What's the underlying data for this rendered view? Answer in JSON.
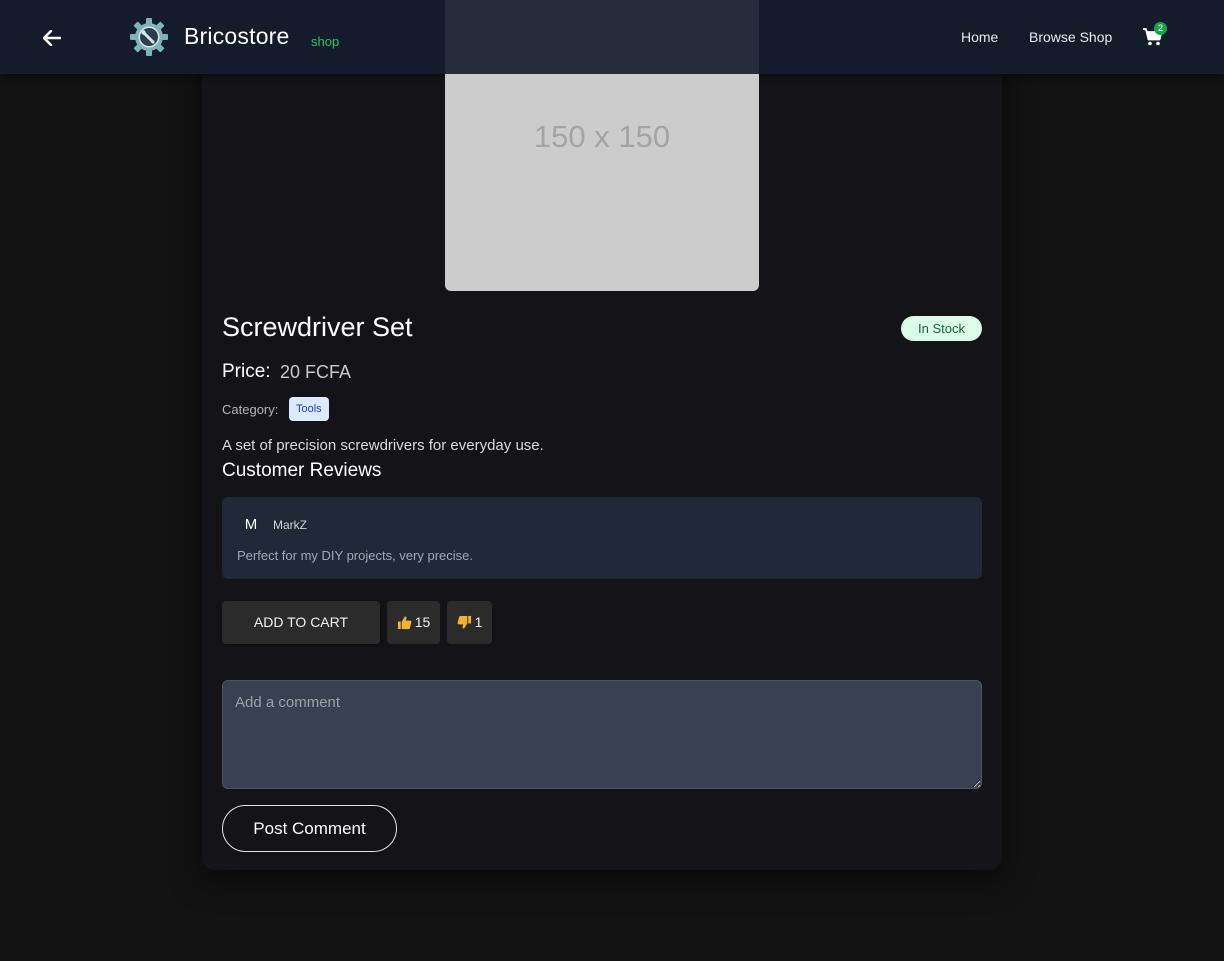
{
  "header": {
    "brand": "Bricostore",
    "brand_sub": "shop",
    "nav": {
      "home": "Home",
      "browse": "Browse Shop"
    },
    "cart_count": "2"
  },
  "product": {
    "image_placeholder": "150 x 150",
    "title": "Screwdriver Set",
    "stock": "In Stock",
    "price_label": "Price:",
    "price_value": "20 FCFA",
    "category_label": "Category:",
    "category": "Tools",
    "description": "A set of precision screwdrivers for everyday use."
  },
  "reviews": {
    "title": "Customer Reviews",
    "items": [
      {
        "initial": "M",
        "author": "MarkZ",
        "text": "Perfect for my DIY projects, very precise."
      }
    ]
  },
  "actions": {
    "add_to_cart": "ADD TO CART",
    "likes": "15",
    "dislikes": "1"
  },
  "comment": {
    "placeholder": "Add a comment",
    "post_label": "Post Comment"
  },
  "colors": {
    "header_bg": "#141c2c",
    "accent_green": "#22c55e",
    "stock_badge_bg": "#dcfce7",
    "category_tag_bg": "#dbeafe"
  },
  "icons": {
    "back": "arrow-left-icon",
    "logo": "gear-wrench-logo",
    "cart": "shopping-cart-icon",
    "like": "thumbs-up-icon",
    "dislike": "thumbs-down-icon"
  }
}
